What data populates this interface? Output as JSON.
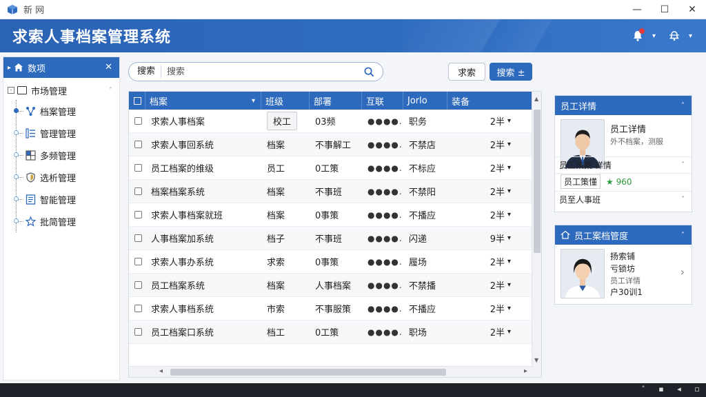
{
  "window": {
    "app_name": "新  网",
    "minimize": "—",
    "maximize": "☐",
    "close": "✕"
  },
  "header": {
    "title": "求索人事档案管理系统"
  },
  "sidebar": {
    "title": "数项",
    "close": "✕",
    "root": {
      "toggle": "-",
      "label": "市场管理"
    },
    "items": [
      {
        "label": "档案管理",
        "icon": "network-icon"
      },
      {
        "label": "管理管理",
        "icon": "list-icon"
      },
      {
        "label": "多频管理",
        "icon": "grid-icon"
      },
      {
        "label": "选析管理",
        "icon": "shield-icon"
      },
      {
        "label": "智能管理",
        "icon": "document-icon"
      },
      {
        "label": "批简管理",
        "icon": "star-icon"
      }
    ]
  },
  "search": {
    "label": "搜索",
    "placeholder": "搜索"
  },
  "toolbar": {
    "query_label": "求索",
    "search_label": "搜索 ±"
  },
  "table": {
    "columns": [
      "档案",
      "班级",
      "部署",
      "互联",
      "Jorlo",
      "装备"
    ],
    "rows": [
      {
        "name": "求索人事档案",
        "col2": "校工",
        "col3": "03频",
        "col4": "●●●●.",
        "col5": "职务",
        "count": "2半"
      },
      {
        "name": "求索人事回系统",
        "col2": "档案",
        "col3": "不事解工",
        "col4": "●●●●.",
        "col5": "不禁店",
        "count": "2半"
      },
      {
        "name": "员工档案的维级",
        "col2": "员工",
        "col3": "0工策",
        "col4": "●●●●.",
        "col5": "不标应",
        "count": "2半"
      },
      {
        "name": "档案档案系统",
        "col2": "档案",
        "col3": "不事班",
        "col4": "●●●●.",
        "col5": "不禁阳",
        "count": "2半"
      },
      {
        "name": "求索人事档案就班",
        "col2": "档案",
        "col3": "0事策",
        "col4": "●●●●.",
        "col5": "不播应",
        "count": "2半"
      },
      {
        "name": "人事档案加系统",
        "col2": "档子",
        "col3": "不事班",
        "col4": "●●●●.",
        "col5": "闪递",
        "count": "9半"
      },
      {
        "name": "求索人事办系统",
        "col2": "求索",
        "col3": "0事策",
        "col4": "●●●●.",
        "col5": "履场",
        "count": "2半"
      },
      {
        "name": "员工档案系统",
        "col2": "档案",
        "col3": "人事档案",
        "col4": "●●●●.",
        "col5": "不禁播",
        "count": "2半"
      },
      {
        "name": "求索人事档系统",
        "col2": "市索",
        "col3": "不事服策",
        "col4": "●●●●.",
        "col5": "不播应",
        "count": "2半"
      },
      {
        "name": "员工档案口系统",
        "col2": "档工",
        "col3": "0工策",
        "col4": "●●●●.",
        "col5": "职场",
        "count": "2半"
      }
    ]
  },
  "employee_card": {
    "title": "员工详情",
    "name": "员工详情",
    "subtitle": "外不档案，测服",
    "rows": {
      "r1": "员工策案 详情",
      "r2_pill": "员工策懂",
      "r2_value": "★ 960",
      "r3": "员至人事班"
    }
  },
  "archive_card": {
    "title": "员工案档管度",
    "lines": [
      "扬索铺",
      "亏锁坊",
      "员工详情",
      "户30训1"
    ]
  },
  "colors": {
    "primary": "#2d69bc",
    "header": "#2f6cc0",
    "accent_green": "#2e9a3e",
    "notification": "#e53935"
  }
}
